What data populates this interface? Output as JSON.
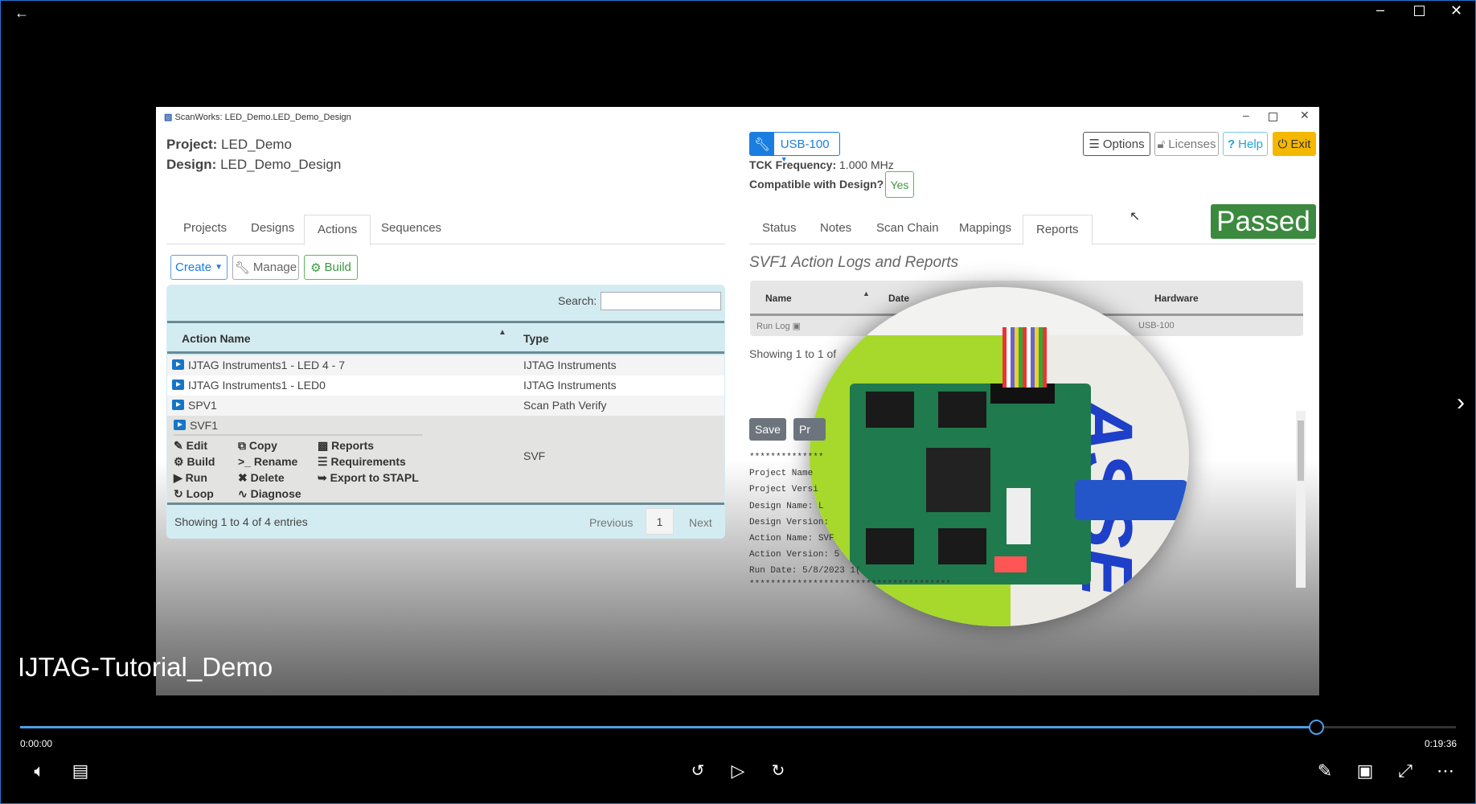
{
  "player": {
    "title": "IJTAG-Tutorial_Demo",
    "current_time": "0:00:00",
    "total_time": "0:19:36",
    "progress_fraction": 0.903,
    "accent": "#4aa0e6"
  },
  "app": {
    "window_title": "ScanWorks: LED_Demo.LED_Demo_Design",
    "project_label": "Project:",
    "project": "LED_Demo",
    "design_label": "Design:",
    "design": "LED_Demo_Design",
    "left_tabs": [
      "Projects",
      "Designs",
      "Actions",
      "Sequences"
    ],
    "left_active": "Actions",
    "toolbar": {
      "create": "Create",
      "manage": "Manage",
      "build": "Build"
    },
    "search_label": "Search:",
    "search_value": "",
    "table": {
      "headers": [
        "Action Name",
        "Type"
      ],
      "rows": [
        {
          "name": "IJTAG Instruments1 - LED 4 - 7",
          "type": "IJTAG Instruments"
        },
        {
          "name": "IJTAG Instruments1 - LED0",
          "type": "IJTAG Instruments"
        },
        {
          "name": "SPV1",
          "type": "Scan Path Verify"
        },
        {
          "name": "SVF1",
          "type": "SVF"
        }
      ],
      "menu": [
        "Edit",
        "Copy",
        "Reports",
        "Build",
        "Rename",
        "Requirements",
        "Run",
        "Delete",
        "Export to STAPL",
        "Loop",
        "Diagnose"
      ],
      "footer": "Showing 1 to 4 of 4 entries",
      "previous": "Previous",
      "page": "1",
      "next": "Next"
    },
    "hardware": {
      "adapter": "USB-100",
      "tck_label": "TCK Frequency:",
      "tck": "1.000 MHz",
      "compat_label": "Compatible with Design?",
      "compat": "Yes"
    },
    "top_buttons": {
      "options": "Options",
      "licenses": "Licenses",
      "help": "Help",
      "exit": "Exit"
    },
    "right_tabs": [
      "Status",
      "Notes",
      "Scan Chain",
      "Mappings",
      "Reports"
    ],
    "right_active": "Reports",
    "status_badge": "Passed",
    "reports": {
      "heading": "SVF1 Action Logs and Reports",
      "headers": [
        "Name",
        "Date",
        "Hardware"
      ],
      "row": {
        "name": "Run Log",
        "hardware": "USB-100"
      },
      "showing": "Showing 1 to 1 of",
      "save": "Save",
      "print": "Pr",
      "log": [
        "**************",
        "Project Name",
        "Project Versi",
        "Design Name: L",
        "Design Version:",
        "Action Name: SVF",
        "Action Version: 5",
        "Run Date: 5/8/2023 1(",
        "**************************************"
      ]
    },
    "colors": {
      "blue": "#1a7ee0",
      "green": "#3c8a3f",
      "yellow": "#f5b800",
      "panel": "#d3ecf2"
    }
  }
}
